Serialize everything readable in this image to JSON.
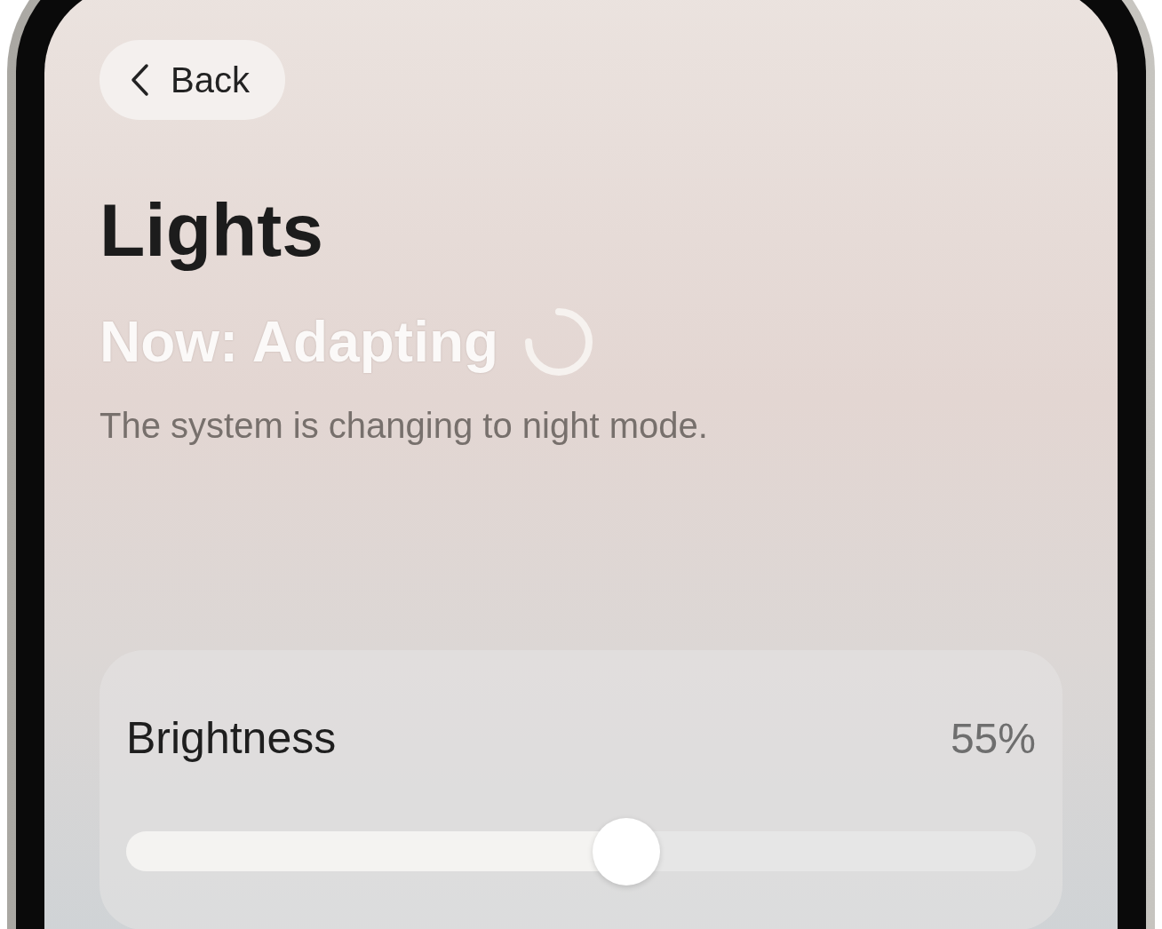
{
  "back_button": {
    "label": "Back"
  },
  "title": "Lights",
  "status": {
    "text": "Now: Adapting",
    "loading": true
  },
  "description": "The system is changing to night mode.",
  "brightness": {
    "label": "Brightness",
    "reading": "55%",
    "level": 0.55
  }
}
